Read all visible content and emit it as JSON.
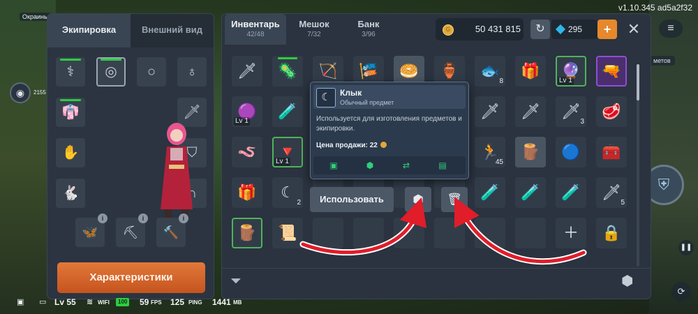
{
  "version": "v1.10.345 ad5a2f32",
  "world": {
    "location_chip": "Окраины",
    "left_number": "2155",
    "right_chip": "метов"
  },
  "equipment": {
    "tabs": [
      "Экипировка",
      "Внешний вид"
    ],
    "stats_button": "Характеристики",
    "info_badge": "i"
  },
  "inventory": {
    "tabs": [
      {
        "label": "Инвентарь",
        "count": "42/48"
      },
      {
        "label": "Мешок",
        "count": "7/32"
      },
      {
        "label": "Банк",
        "count": "3/96"
      }
    ],
    "gold": "50 431 815",
    "gold_icon_letter": "G",
    "gems": "295",
    "items": [
      {
        "icon": "🗡",
        "cls": ""
      },
      {
        "icon": "🦠",
        "cls": "",
        "greenbar": true
      },
      {
        "icon": "🏹",
        "cls": ""
      },
      {
        "icon": "🎏",
        "cls": ""
      },
      {
        "icon": "🥯",
        "cls": "light"
      },
      {
        "icon": "🏺",
        "cls": ""
      },
      {
        "icon": "🐟",
        "cls": "",
        "qty": "8"
      },
      {
        "icon": "🎁",
        "cls": ""
      },
      {
        "icon": "🔮",
        "cls": "green",
        "lv": "Lv 1"
      },
      {
        "icon": "🔫",
        "cls": "purple"
      },
      {
        "icon": "🟣",
        "cls": "",
        "lv": "Lv 1"
      },
      {
        "icon": "🧪",
        "cls": ""
      },
      {
        "icon": "",
        "cls": ""
      },
      {
        "icon": "",
        "cls": ""
      },
      {
        "icon": "",
        "cls": ""
      },
      {
        "icon": "",
        "cls": ""
      },
      {
        "icon": "🗡",
        "cls": ""
      },
      {
        "icon": "🗡",
        "cls": ""
      },
      {
        "icon": "🗡",
        "cls": "",
        "qty": "3"
      },
      {
        "icon": "🥩",
        "cls": ""
      },
      {
        "icon": "🪱",
        "cls": ""
      },
      {
        "icon": "🔻",
        "cls": "green",
        "lv": "Lv 1"
      },
      {
        "icon": "",
        "cls": ""
      },
      {
        "icon": "",
        "cls": ""
      },
      {
        "icon": "",
        "cls": ""
      },
      {
        "icon": "",
        "cls": ""
      },
      {
        "icon": "🏃",
        "cls": "",
        "qty": "45"
      },
      {
        "icon": "🪵",
        "cls": "light"
      },
      {
        "icon": "🔵",
        "cls": ""
      },
      {
        "icon": "🧰",
        "cls": ""
      },
      {
        "icon": "🎁",
        "cls": ""
      },
      {
        "icon": "☾",
        "cls": "",
        "qty": "2"
      },
      {
        "icon": "",
        "cls": ""
      },
      {
        "icon": "",
        "cls": ""
      },
      {
        "icon": "",
        "cls": ""
      },
      {
        "icon": "",
        "cls": ""
      },
      {
        "icon": "🧪",
        "cls": ""
      },
      {
        "icon": "🧪",
        "cls": ""
      },
      {
        "icon": "🧪",
        "cls": ""
      },
      {
        "icon": "🗡",
        "cls": "",
        "qty": "5"
      },
      {
        "icon": "🪵",
        "cls": "green"
      },
      {
        "icon": "📜",
        "cls": ""
      },
      {
        "icon": "",
        "cls": ""
      },
      {
        "icon": "",
        "cls": ""
      },
      {
        "icon": "",
        "cls": ""
      },
      {
        "icon": "",
        "cls": ""
      },
      {
        "icon": "",
        "cls": ""
      },
      {
        "icon": "",
        "cls": ""
      },
      {
        "icon": "＋",
        "cls": ""
      },
      {
        "icon": "🔒",
        "cls": ""
      }
    ]
  },
  "tooltip": {
    "name": "Клык",
    "rarity": "Обычный предмет",
    "description": "Используется для изготовления предметов и экипировки.",
    "price_label": "Цена продажи: 22"
  },
  "context": {
    "use_button": "Использовать"
  },
  "status": {
    "level": "Lv 55",
    "wifi": "WIFI",
    "wifi_strength": "100",
    "fps": "59",
    "fps_unit": "FPS",
    "ping": "125",
    "ping_unit": "PING",
    "memory": "1441",
    "memory_unit": "MB"
  },
  "colors": {
    "accent_orange": "#e7882c",
    "gold": "#e0a93a",
    "gem": "#2fb6e8",
    "highlight_green": "#4fb35a",
    "arrow_red": "#e11d2a"
  }
}
